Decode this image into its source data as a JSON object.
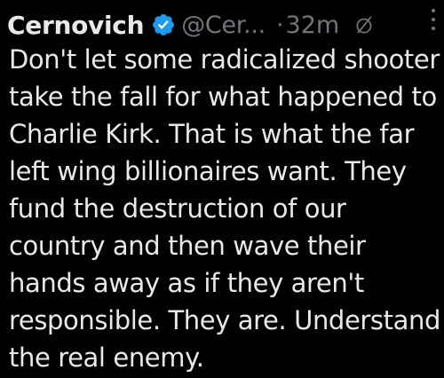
{
  "tweet": {
    "display_name": "Cernovich",
    "handle": "@Cer...",
    "separator": "·",
    "time": "32m",
    "verified_icon": "verified-badge-icon",
    "edited_icon": "edit-icon",
    "more_icon": "more-options-icon",
    "lines": [
      "Don't let some radicalized shooter",
      "take the fall for what happened to",
      "Charlie Kirk. That is what the far",
      "left wing billionaires want. They",
      "fund the destruction of our",
      "country and then wave their",
      "hands away as if they aren't",
      "responsible. They are. Understand",
      "the real enemy."
    ]
  },
  "colors": {
    "background": "#000000",
    "text_primary": "#e7e9ea",
    "text_secondary": "#71767b",
    "verified_blue": "#1d9bf0"
  }
}
